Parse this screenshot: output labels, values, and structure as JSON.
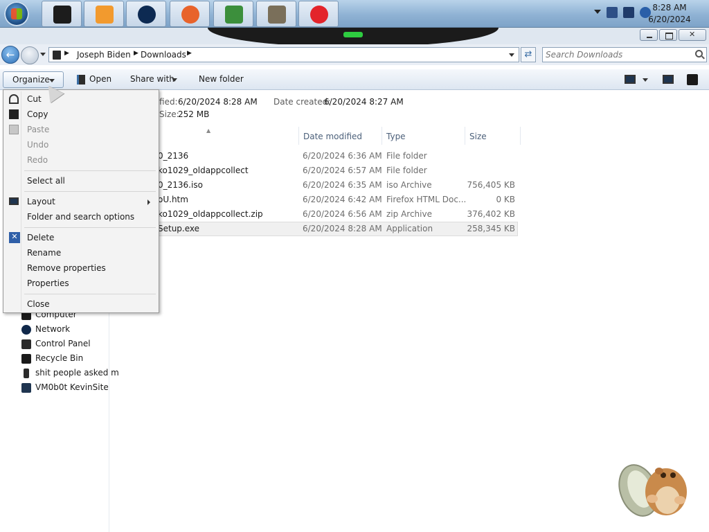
{
  "taskbar": {
    "apps": [
      {
        "name": "explorer-app-icon",
        "color": "#1c1c1c"
      },
      {
        "name": "media-player-app-icon",
        "color": "#f29a2e"
      },
      {
        "name": "globe-app-icon",
        "color": "#0d2a52"
      },
      {
        "name": "firefox-app-icon",
        "color": "#e8632b"
      },
      {
        "name": "users-app-icon",
        "color": "#3c8f3c"
      },
      {
        "name": "tools-app-icon",
        "color": "#7a6f5a"
      },
      {
        "name": "video-app-icon",
        "color": "#e3242b"
      }
    ],
    "clock_time": "8:28 AM",
    "clock_date": "6/20/2024"
  },
  "address": {
    "crumbs": [
      "Joseph Biden",
      "Downloads"
    ],
    "search_placeholder": "Search Downloads"
  },
  "toolbar": {
    "organize": "Organize",
    "open": "Open",
    "share_with": "Share with",
    "new_folder": "New folder"
  },
  "details": {
    "modified_label": "fied:",
    "modified_value": "6/20/2024 8:28 AM",
    "created_label": "Date created:",
    "created_value": "6/20/2024 8:27 AM",
    "size_label": "Size:",
    "size_value": "252 MB"
  },
  "columns": {
    "date_modified": "Date modified",
    "type": "Type",
    "size": "Size"
  },
  "files": [
    {
      "name": "0_2136",
      "date": "6/20/2024 6:36 AM",
      "type": "File folder",
      "size": ""
    },
    {
      "name": "ko1029_oldappcollect",
      "date": "6/20/2024 6:57 AM",
      "type": "File folder",
      "size": ""
    },
    {
      "name": "0_2136.iso",
      "date": "6/20/2024 6:35 AM",
      "type": "iso Archive",
      "size": "756,405 KB"
    },
    {
      "name": "oU.htm",
      "date": "6/20/2024 6:42 AM",
      "type": "Firefox HTML Doc...",
      "size": "0 KB"
    },
    {
      "name": "ko1029_oldappcollect.zip",
      "date": "6/20/2024 6:56 AM",
      "type": "zip Archive",
      "size": "376,402 KB"
    },
    {
      "name": "Setup.exe",
      "date": "6/20/2024 8:28 AM",
      "type": "Application",
      "size": "258,345 KB"
    }
  ],
  "nav": [
    {
      "label": "Computer",
      "icon": "computer-icon"
    },
    {
      "label": "Network",
      "icon": "network-icon"
    },
    {
      "label": "Control Panel",
      "icon": "control-panel-icon"
    },
    {
      "label": "Recycle Bin",
      "icon": "recycle-bin-icon"
    },
    {
      "label": "shit people asked m",
      "icon": "folder-icon"
    },
    {
      "label": "VM0b0t KevinSite",
      "icon": "shortcut-icon"
    }
  ],
  "menu": {
    "cut": "Cut",
    "copy": "Copy",
    "paste": "Paste",
    "undo": "Undo",
    "redo": "Redo",
    "select_all": "Select all",
    "layout": "Layout",
    "folder_options": "Folder and search options",
    "delete": "Delete",
    "rename": "Rename",
    "remove_properties": "Remove properties",
    "properties": "Properties",
    "close": "Close"
  }
}
